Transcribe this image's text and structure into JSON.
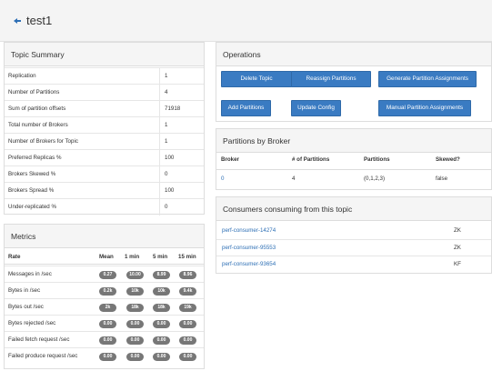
{
  "header": {
    "title": "test1"
  },
  "topic_summary": {
    "title": "Topic Summary",
    "rows": [
      {
        "label": "Replication",
        "value": "1"
      },
      {
        "label": "Number of Partitions",
        "value": "4"
      },
      {
        "label": "Sum of partition offsets",
        "value": "71918"
      },
      {
        "label": "Total number of Brokers",
        "value": "1"
      },
      {
        "label": "Number of Brokers for Topic",
        "value": "1"
      },
      {
        "label": "Preferred Replicas %",
        "value": "100"
      },
      {
        "label": "Brokers Skewed %",
        "value": "0"
      },
      {
        "label": "Brokers Spread %",
        "value": "100"
      },
      {
        "label": "Under-replicated %",
        "value": "0"
      }
    ]
  },
  "metrics": {
    "title": "Metrics",
    "columns": [
      "Rate",
      "Mean",
      "1 min",
      "5 min",
      "15 min"
    ],
    "rows": [
      {
        "label": "Messages in /sec",
        "values": [
          "0.27",
          "10.00",
          "8.99",
          "8.96"
        ]
      },
      {
        "label": "Bytes in /sec",
        "values": [
          "0.2k",
          "10k",
          "10k",
          "9.4k"
        ]
      },
      {
        "label": "Bytes out /sec",
        "values": [
          "2k",
          "18k",
          "18k",
          "19k"
        ]
      },
      {
        "label": "Bytes rejected /sec",
        "values": [
          "0.00",
          "0.00",
          "0.00",
          "0.00"
        ]
      },
      {
        "label": "Failed fetch request /sec",
        "values": [
          "0.00",
          "0.00",
          "0.00",
          "0.00"
        ]
      },
      {
        "label": "Failed produce request /sec",
        "values": [
          "0.00",
          "0.00",
          "0.00",
          "0.00"
        ]
      }
    ]
  },
  "operations": {
    "title": "Operations",
    "buttons": [
      "Delete Topic",
      "Reassign Partitions",
      "Generate Partition Assignments",
      "Add Partitions",
      "Update Config",
      "Manual Partition Assignments"
    ]
  },
  "partitions_by_broker": {
    "title": "Partitions by Broker",
    "columns": [
      "Broker",
      "# of Partitions",
      "Partitions",
      "Skewed?"
    ],
    "rows": [
      {
        "broker": "0",
        "count": "4",
        "partitions": "(0,1,2,3)",
        "skewed": "false"
      }
    ]
  },
  "consumers": {
    "title": "Consumers consuming from this topic",
    "rows": [
      {
        "name": "perf-consumer-14274",
        "type": "ZK"
      },
      {
        "name": "perf-consumer-95553",
        "type": "ZK"
      },
      {
        "name": "perf-consumer-93654",
        "type": "KF"
      }
    ]
  },
  "colors": {
    "button": "#3a7bc2",
    "link": "#2d6fb5",
    "badge": "#777777"
  },
  "icons": {
    "back": "arrow-left-icon"
  }
}
